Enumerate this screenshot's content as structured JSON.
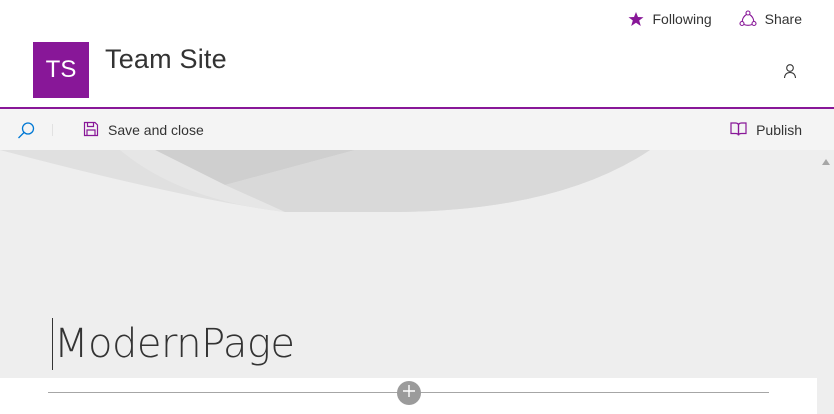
{
  "colors": {
    "brand": "#881798",
    "accent_blue": "#0078d4",
    "text": "#333333",
    "command_bar_bg": "#f4f4f4",
    "canvas_bg": "#eeeeee"
  },
  "site": {
    "logo_initials": "TS",
    "title": "Team Site"
  },
  "top_actions": {
    "following_label": "Following",
    "following_icon": "star-filled-icon",
    "share_label": "Share",
    "share_icon": "share-icon",
    "person_icon": "person-icon"
  },
  "command_bar": {
    "search_icon": "search-icon",
    "save_label": "Save and close",
    "save_icon": "save-icon",
    "publish_label": "Publish",
    "publish_icon": "publish-book-icon"
  },
  "page": {
    "title": "ModernPage"
  },
  "section": {
    "add_icon": "plus-icon"
  }
}
